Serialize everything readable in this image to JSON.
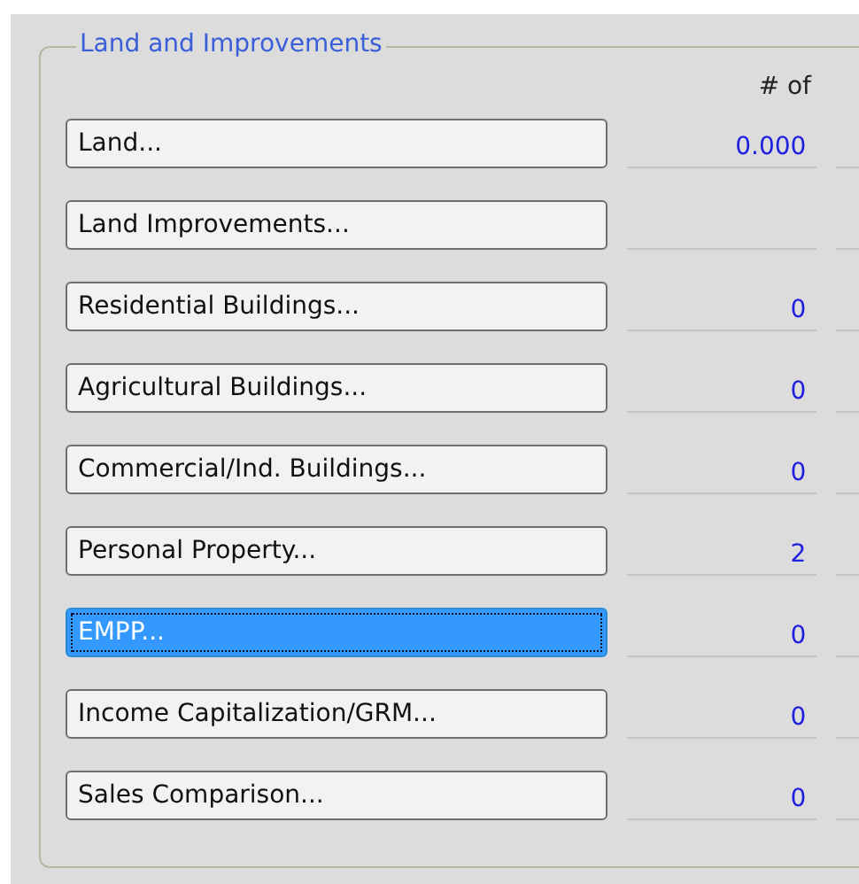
{
  "group": {
    "title": "Land and Improvements",
    "column_header": "# of",
    "rows": [
      {
        "label": "Land...",
        "value": "0.000",
        "focused": false
      },
      {
        "label": "Land Improvements...",
        "focused": false
      },
      {
        "label": "Residential Buildings...",
        "value": "0",
        "focused": false
      },
      {
        "label": "Agricultural Buildings...",
        "value": "0",
        "focused": false
      },
      {
        "label": "Commercial/Ind. Buildings...",
        "value": "0",
        "focused": false
      },
      {
        "label": "Personal Property...",
        "value": "2",
        "focused": false
      },
      {
        "label": "EMPP...",
        "value": "0",
        "focused": true
      },
      {
        "label": "Income Capitalization/GRM...",
        "value": "0",
        "focused": false
      },
      {
        "label": "Sales Comparison...",
        "value": "0",
        "focused": false
      }
    ]
  }
}
